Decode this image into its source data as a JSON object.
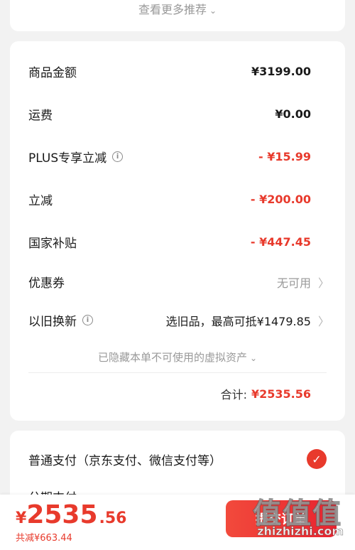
{
  "recommend": {
    "more_label": "查看更多推荐"
  },
  "summary": {
    "rows": [
      {
        "label": "商品金额",
        "value": "¥3199.00"
      },
      {
        "label": "运费",
        "value": "¥0.00"
      },
      {
        "label": "PLUS专享立减",
        "value": "- ¥15.99"
      },
      {
        "label": "立减",
        "value": "- ¥200.00"
      },
      {
        "label": "国家补贴",
        "value": "- ¥447.45"
      }
    ],
    "coupon": {
      "label": "优惠券",
      "value": "无可用"
    },
    "tradein": {
      "label": "以旧换新",
      "value": "选旧品，最高可抵¥1479.85"
    },
    "hidden_assets": "已隐藏本单不可使用的虚拟资产",
    "total_label": "合计:",
    "total_value": "¥2535.56"
  },
  "payment": {
    "option1": "普通支付（京东支付、微信支付等）",
    "option2": "分期支付"
  },
  "bottom": {
    "currency": "¥",
    "price_int": "2535",
    "price_dec": ".56",
    "saved": "共减¥663.44",
    "submit_label": "提交订单"
  },
  "watermark": {
    "big": "值值值",
    "small": "zhizhizhi.com"
  },
  "colors": {
    "accent": "#e83a2c",
    "muted": "#999999",
    "background": "#f2f2f2"
  },
  "icons": {
    "info": "info-circle-icon",
    "chevron": "chevron-right-icon",
    "check": "check-circle-icon"
  }
}
